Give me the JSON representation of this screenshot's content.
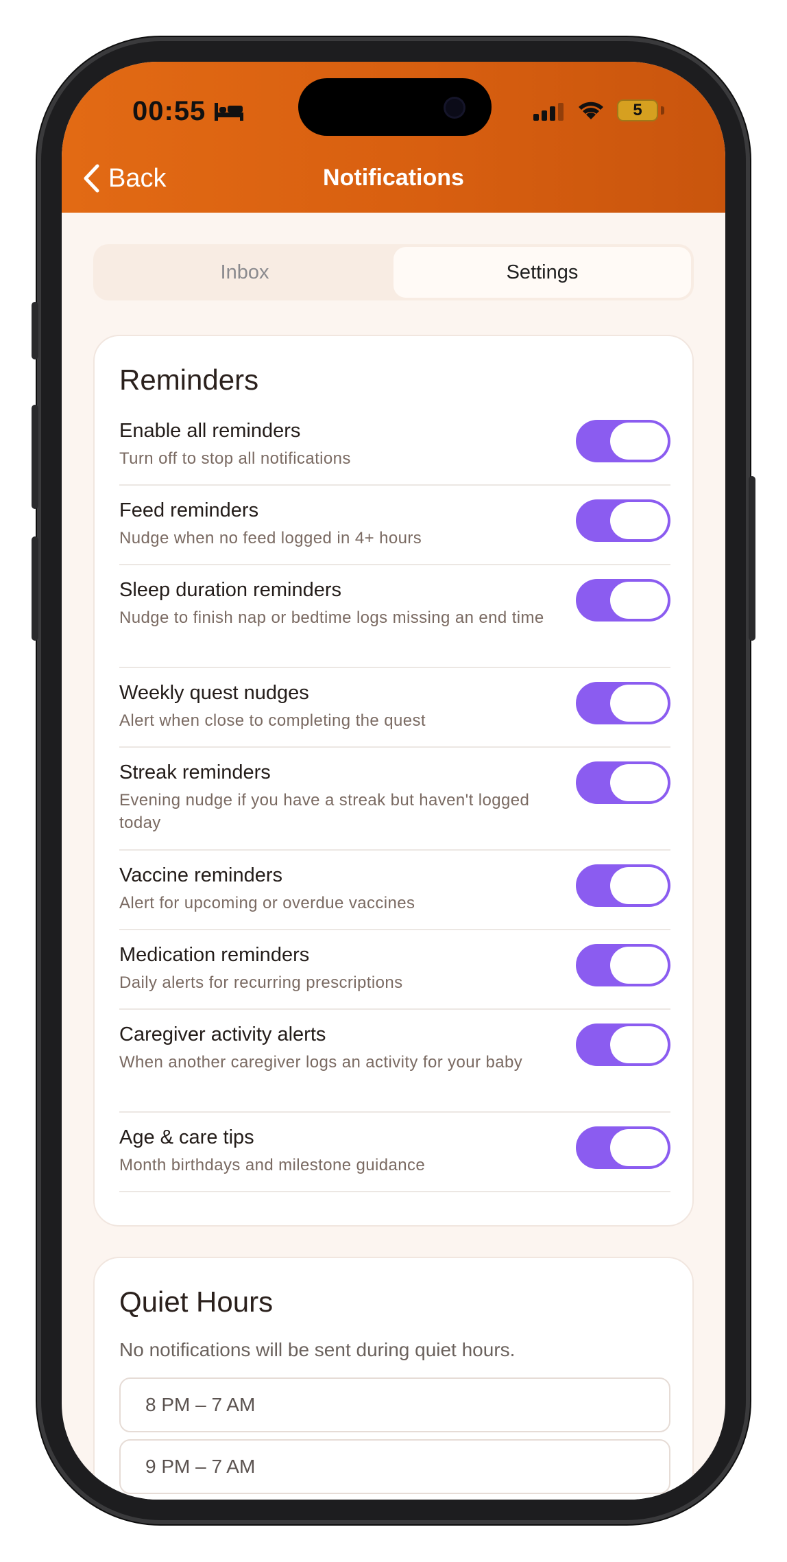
{
  "status_bar": {
    "time": "00:55",
    "battery": "5"
  },
  "nav": {
    "back_label": "Back",
    "title": "Notifications"
  },
  "tabs": [
    {
      "label": "Inbox",
      "active": false
    },
    {
      "label": "Settings",
      "active": true
    }
  ],
  "reminders": {
    "title": "Reminders",
    "items": [
      {
        "title": "Enable all reminders",
        "subtitle": "Turn off to stop all notifications",
        "enabled": true
      },
      {
        "title": "Feed reminders",
        "subtitle": "Nudge when no feed logged in 4+ hours",
        "enabled": true
      },
      {
        "title": "Sleep duration reminders",
        "subtitle": "Nudge to finish nap or bedtime logs missing an end time",
        "enabled": true
      },
      {
        "title": "Weekly quest nudges",
        "subtitle": "Alert when close to completing the quest",
        "enabled": true
      },
      {
        "title": "Streak reminders",
        "subtitle": "Evening nudge if you have a streak but haven't logged today",
        "enabled": true
      },
      {
        "title": "Vaccine reminders",
        "subtitle": "Alert for upcoming or overdue vaccines",
        "enabled": true
      },
      {
        "title": "Medication reminders",
        "subtitle": "Daily alerts for recurring prescriptions",
        "enabled": true
      },
      {
        "title": "Caregiver activity alerts",
        "subtitle": "When another caregiver logs an activity for your baby",
        "enabled": true
      },
      {
        "title": "Age & care tips",
        "subtitle": "Month birthdays and milestone guidance",
        "enabled": true
      }
    ]
  },
  "quiet_hours": {
    "title": "Quiet Hours",
    "subtitle": "No notifications will be sent during quiet hours.",
    "options": [
      "8 PM – 7 AM",
      "9 PM – 7 AM"
    ]
  },
  "colors": {
    "header": "#e26a14",
    "toggle_on": "#8b5cf0",
    "background": "#fcf5f0"
  }
}
